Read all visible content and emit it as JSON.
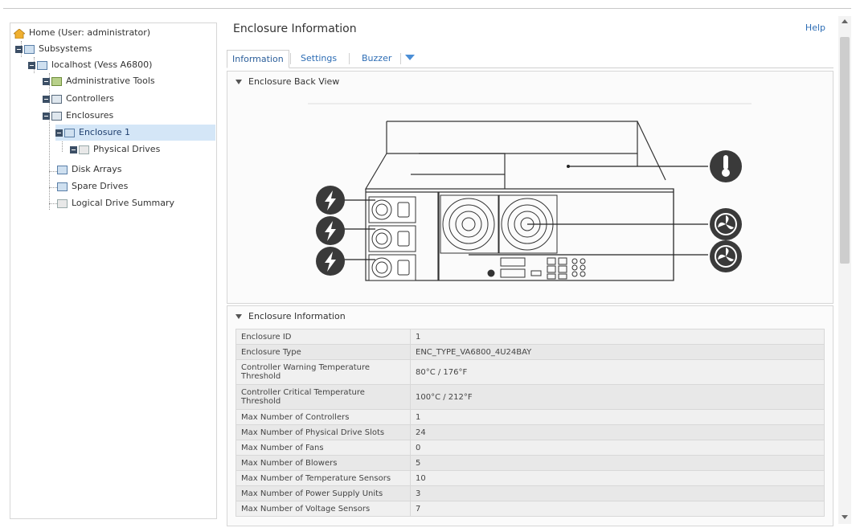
{
  "tree": {
    "home": "Home (User: administrator)",
    "subsystems": "Subsystems",
    "host": "localhost (Vess A6800)",
    "admin_tools": "Administrative Tools",
    "controllers": "Controllers",
    "enclosures": "Enclosures",
    "enclosure1": "Enclosure 1",
    "physical_drives": "Physical Drives",
    "disk_arrays": "Disk Arrays",
    "spare_drives": "Spare Drives",
    "logical_summary": "Logical Drive Summary"
  },
  "header": {
    "title": "Enclosure Information",
    "help": "Help"
  },
  "tabs": [
    {
      "label": "Information"
    },
    {
      "label": "Settings"
    },
    {
      "label": "Buzzer"
    }
  ],
  "back_view": {
    "title": "Enclosure Back View"
  },
  "info": {
    "title": "Enclosure Information",
    "rows": [
      {
        "k": "Enclosure ID",
        "v": "1"
      },
      {
        "k": "Enclosure Type",
        "v": "ENC_TYPE_VA6800_4U24BAY"
      },
      {
        "k": "Controller Warning Temperature Threshold",
        "v": "80°C / 176°F"
      },
      {
        "k": "Controller Critical Temperature Threshold",
        "v": "100°C / 212°F"
      },
      {
        "k": "Max Number of Controllers",
        "v": "1"
      },
      {
        "k": "Max Number of Physical Drive Slots",
        "v": "24"
      },
      {
        "k": "Max Number of Fans",
        "v": "0"
      },
      {
        "k": "Max Number of Blowers",
        "v": "5"
      },
      {
        "k": "Max Number of Temperature Sensors",
        "v": "10"
      },
      {
        "k": "Max Number of Power Supply Units",
        "v": "3"
      },
      {
        "k": "Max Number of Voltage Sensors",
        "v": "7"
      }
    ]
  },
  "icons": {
    "power": "power-bolt-icon",
    "thermometer": "thermometer-icon",
    "fan": "fan-icon"
  },
  "colors": {
    "accent": "#2d6db5",
    "selected": "#d4e6f7",
    "icon_dark": "#3a3a3a"
  }
}
